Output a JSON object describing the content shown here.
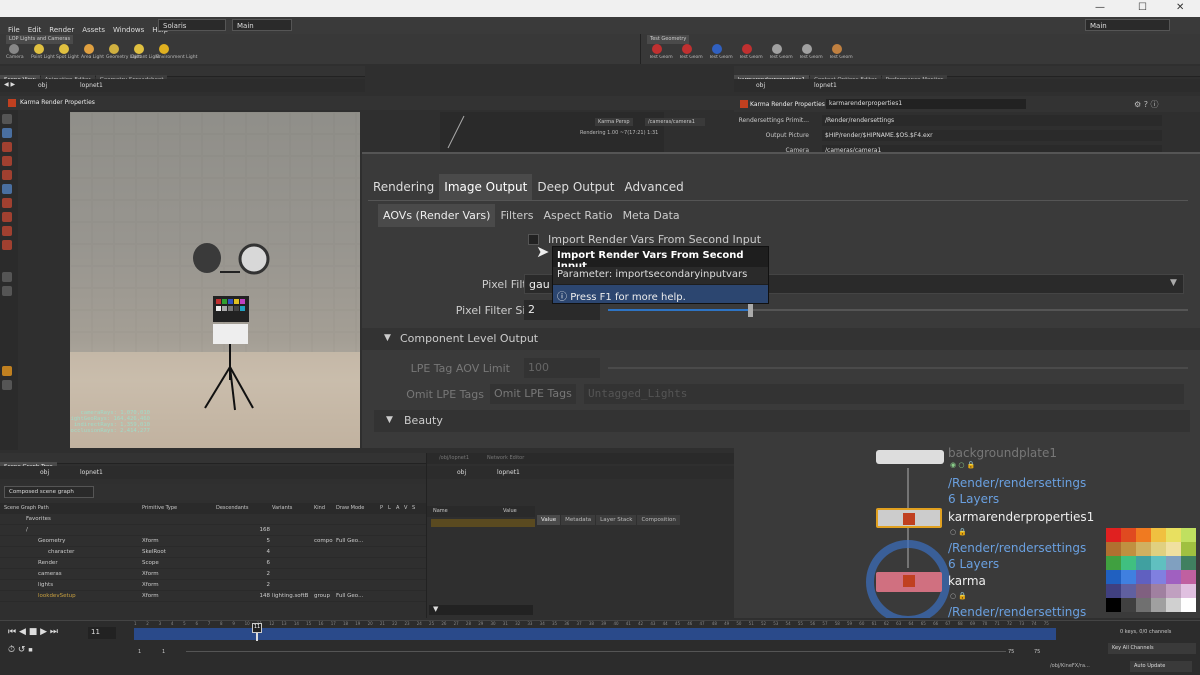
{
  "window": {
    "min": "—",
    "max": "☐",
    "close": "✕"
  },
  "menu": [
    "File",
    "Edit",
    "Render",
    "Assets",
    "Windows",
    "Help"
  ],
  "desktop": "Solaris",
  "desk_tab": "Main",
  "desk_right": "Main",
  "shelf_left": {
    "tab": "LOP Lights and Cameras",
    "tools": [
      "Camera",
      "Point Light",
      "Spot Light",
      "Area Light",
      "Geometry Light",
      "Distant Light",
      "Environment Light"
    ]
  },
  "shelf_right": {
    "tab": "Test Geometry",
    "tools": [
      "Test Geometry: ...",
      "Test Geometry: ...",
      "Test Geometry: ...",
      "Test Geometry: S...",
      "Test Geometry: T...",
      "Test Geometry: T...",
      "Test Geometry: T..."
    ]
  },
  "left_tabs": [
    "Scene View",
    "Animation Editor",
    "Geometry Spreadsheet"
  ],
  "right_tabs": [
    "karmarenderproperties1",
    "Context Options Editor",
    "Performance Monitor"
  ],
  "path": {
    "obj": "obj",
    "net": "lopnet1"
  },
  "viewport": {
    "title": "Karma Render Properties",
    "camera": "Karma Persp",
    "cam_path": "/cameras/camera1",
    "render_status": "Rendering  1.00  ~7(17:21)  1:31",
    "bg_label": "Pixel Samples",
    "stats": [
      "cameraRays:  1,070,010",
      "lightGeoRays:  164,426,460",
      "indirectRays:   1,359,010",
      "occlusionRays:  2,414,277"
    ]
  },
  "props": {
    "header": "Karma Render Properties",
    "node": "karmarenderproperties1",
    "rows": [
      {
        "label": "Rendersettings Primit...",
        "value": "/Render/rendersettings"
      },
      {
        "label": "Output Picture",
        "value": "$HIP/render/$HIPNAME.$OS.$F4.exr"
      },
      {
        "label": "Camera",
        "value": "/cameras/camera1"
      }
    ]
  },
  "zoom": {
    "tabs": [
      "Rendering",
      "Image Output",
      "Deep Output",
      "Advanced"
    ],
    "subtabs": [
      "AOVs (Render Vars)",
      "Filters",
      "Aspect Ratio",
      "Meta Data"
    ],
    "import_label": "Import Render Vars From Second Input",
    "pixel_filter_label": "Pixel Filter",
    "pixel_filter_value": "gau",
    "pixel_filter_size_label": "Pixel Filter Size",
    "pixel_filter_size_value": "2",
    "component_section": "Component Level Output",
    "lpe_label": "LPE Tag AOV Limit",
    "lpe_value": "100",
    "omit_label": "Omit LPE Tags",
    "omit_btn": "Omit LPE Tags",
    "omit_value": "Untagged_Lights",
    "beauty": "Beauty"
  },
  "tooltip": {
    "title": "Import Render Vars From Second Input",
    "param": "Parameter: importsecondaryinputvars",
    "help": "Press F1 for more help."
  },
  "scene_graph": {
    "tab": "Scene Graph Tree",
    "dropdown": "Composed scene graph",
    "headers": [
      "Scene Graph Path",
      "Primitive Type",
      "Descendants",
      "Variants",
      "Kind",
      "Draw Mode",
      "P",
      "L",
      "A",
      "V",
      "S"
    ],
    "rows": [
      {
        "name": "Favorites",
        "type": "",
        "desc": "",
        "var": "",
        "kind": "",
        "draw": ""
      },
      {
        "name": "/",
        "type": "",
        "desc": "168",
        "var": "",
        "kind": "",
        "draw": ""
      },
      {
        "name": "Geometry",
        "type": "Xform",
        "desc": "5",
        "var": "",
        "kind": "compo",
        "draw": "Full Geo..."
      },
      {
        "name": "character",
        "type": "SkelRoot",
        "desc": "4",
        "var": "",
        "kind": "",
        "draw": ""
      },
      {
        "name": "Render",
        "type": "Scope",
        "desc": "6",
        "var": "",
        "kind": "",
        "draw": ""
      },
      {
        "name": "cameras",
        "type": "Xform",
        "desc": "2",
        "var": "",
        "kind": "",
        "draw": ""
      },
      {
        "name": "lights",
        "type": "Xform",
        "desc": "2",
        "var": "",
        "kind": "",
        "draw": ""
      },
      {
        "name": "lookdevSetup",
        "type": "Xform",
        "desc": "148",
        "var": "lighting.softB",
        "kind": "group",
        "draw": "Full Geo..."
      }
    ]
  },
  "attrs": {
    "headers": [
      "Name",
      "Value"
    ],
    "tabs": [
      "Value",
      "Metadata",
      "Layer Stack",
      "Composition"
    ]
  },
  "network": {
    "bg_path": "/obj/lopnet1",
    "bg_tab": "Network Editor",
    "nodes": [
      {
        "name": "backgroundplate1",
        "sub": "/Render/rendersettings",
        "layers": "6 Layers"
      },
      {
        "name": "karmarenderproperties1",
        "sub": "/Render/rendersettings",
        "layers": "6 Layers"
      },
      {
        "name": "karma",
        "sub": "/Render/rendersettings"
      }
    ],
    "colors": [
      "#e02020",
      "#e04a20",
      "#f07a20",
      "#f0c040",
      "#e8e060",
      "#c0e060",
      "#b07030",
      "#c09040",
      "#d0b060",
      "#e0d080",
      "#f0e0a0",
      "#a0c040",
      "#40a040",
      "#40c080",
      "#40a0a0",
      "#60c0c0",
      "#80a0c0",
      "#408060",
      "#2060c0",
      "#4080e0",
      "#6060c0",
      "#8080e0",
      "#a060c0",
      "#c060a0",
      "#404080",
      "#6060a0",
      "#806080",
      "#a080a0",
      "#c0a0c0",
      "#e0c0e0",
      "#000000",
      "#404040",
      "#707070",
      "#a0a0a0",
      "#d0d0d0",
      "#ffffff"
    ]
  },
  "timeline": {
    "frame": "11",
    "start": "1",
    "start2": "1",
    "end": "75",
    "end2": "75",
    "marker": "11",
    "keys": "0 keys, 0/0 channels",
    "key_all": "Key All Channels",
    "path": "/obj/KineFX/ra...",
    "auto": "Auto Update",
    "ticks": [
      "1",
      "2",
      "3",
      "4",
      "5",
      "6",
      "7",
      "8",
      "9",
      "10",
      "11",
      "12",
      "13",
      "14",
      "15",
      "16",
      "17",
      "18",
      "19",
      "20",
      "21",
      "22",
      "23",
      "24",
      "25",
      "26",
      "27",
      "28",
      "29",
      "30",
      "31",
      "32",
      "33",
      "34",
      "35",
      "36",
      "37",
      "38",
      "39",
      "40",
      "41",
      "42",
      "43",
      "44",
      "45",
      "46",
      "47",
      "48",
      "49",
      "50",
      "51",
      "52",
      "53",
      "54",
      "55",
      "56",
      "57",
      "58",
      "59",
      "60",
      "61",
      "62",
      "63",
      "64",
      "65",
      "66",
      "67",
      "68",
      "69",
      "70",
      "71",
      "72",
      "73",
      "74",
      "75"
    ]
  }
}
